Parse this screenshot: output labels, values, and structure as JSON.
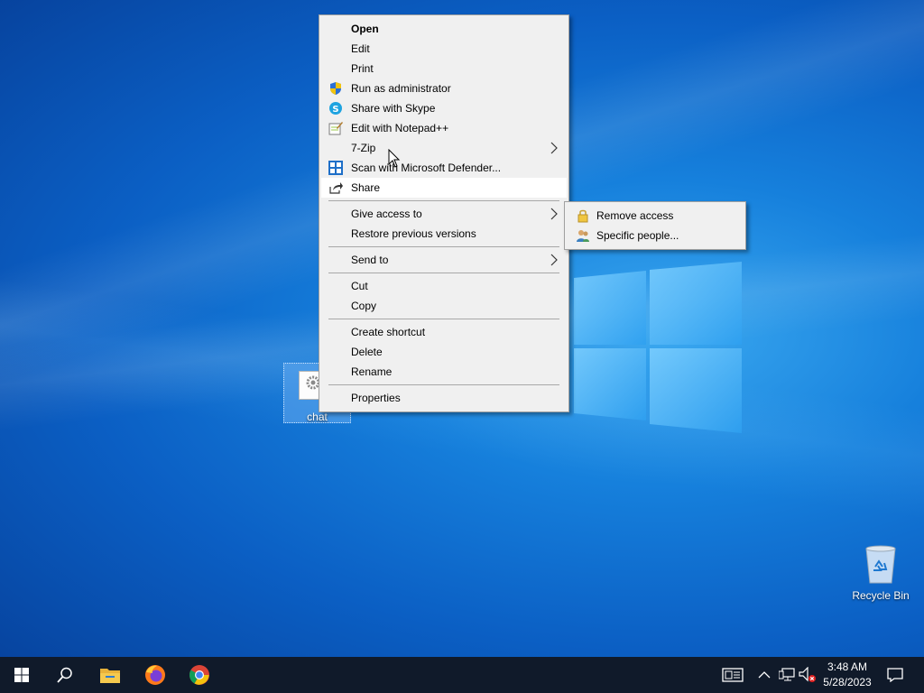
{
  "context_menu": {
    "items": [
      {
        "label": "Open"
      },
      {
        "label": "Edit"
      },
      {
        "label": "Print"
      },
      {
        "label": "Run as administrator",
        "icon": "shield-icon"
      },
      {
        "label": "Share with Skype",
        "icon": "skype-icon"
      },
      {
        "label": "Edit with Notepad++",
        "icon": "notepadpp-icon"
      },
      {
        "label": "7-Zip"
      },
      {
        "label": "Scan with Microsoft Defender...",
        "icon": "defender-icon"
      },
      {
        "label": "Share",
        "icon": "share-icon"
      },
      {
        "label": "Give access to"
      },
      {
        "label": "Restore previous versions"
      },
      {
        "label": "Send to"
      },
      {
        "label": "Cut"
      },
      {
        "label": "Copy"
      },
      {
        "label": "Create shortcut"
      },
      {
        "label": "Delete"
      },
      {
        "label": "Rename"
      },
      {
        "label": "Properties"
      }
    ]
  },
  "submenu": {
    "items": [
      {
        "label": "Remove access",
        "icon": "lock-icon"
      },
      {
        "label": "Specific people...",
        "icon": "people-icon"
      }
    ]
  },
  "desktop": {
    "file_label": "chat",
    "recycle_bin_label": "Recycle Bin"
  },
  "taskbar": {
    "apps": [
      "start-icon",
      "search-icon",
      "file-explorer-icon",
      "firefox-icon",
      "chrome-icon"
    ],
    "clock_time": "3:48 AM",
    "clock_date": "5/28/2023"
  },
  "colors": {
    "taskbar": "#101a2a",
    "menu_bg": "#f0f0f0",
    "hover_bg": "#ffffff"
  }
}
